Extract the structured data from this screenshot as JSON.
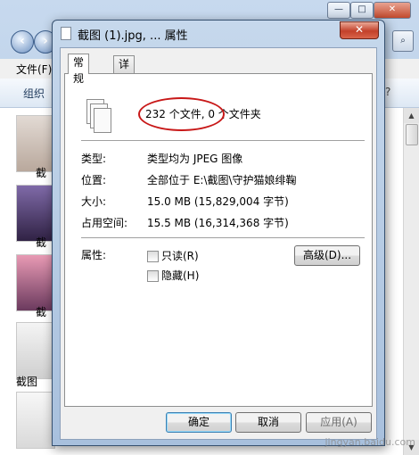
{
  "background": {
    "window_controls": [
      "—",
      "□",
      "✕"
    ],
    "menu_label": "文件(F)",
    "toolbar_label": "组织",
    "thumb_labels": [
      "截",
      "截",
      "截",
      "截图"
    ]
  },
  "dialog": {
    "title": "截图 (1).jpg, ... 属性",
    "close_glyph": "✕",
    "tabs": [
      {
        "label": "常规",
        "active": true
      },
      {
        "label": "详细信息",
        "active": false
      }
    ],
    "file_count": "232 个文件, 0 个文件夹",
    "properties": [
      {
        "label": "类型:",
        "value": "类型均为 JPEG 图像"
      },
      {
        "label": "位置:",
        "value": "全部位于 E:\\截图\\守护猫娘绯鞠"
      },
      {
        "label": "大小:",
        "value": "15.0 MB (15,829,004 字节)"
      },
      {
        "label": "占用空间:",
        "value": "15.5 MB (16,314,368 字节)"
      }
    ],
    "attributes_label": "属性:",
    "readonly_label": "只读(R)",
    "hidden_label": "隐藏(H)",
    "advanced_label": "高级(D)...",
    "ok_label": "确定",
    "cancel_label": "取消",
    "apply_label": "应用(A)"
  },
  "watermark": "jingyan.baidu.com",
  "colors": {
    "highlight_oval": "#c81818",
    "default_button_border": "#3c7fb1"
  }
}
